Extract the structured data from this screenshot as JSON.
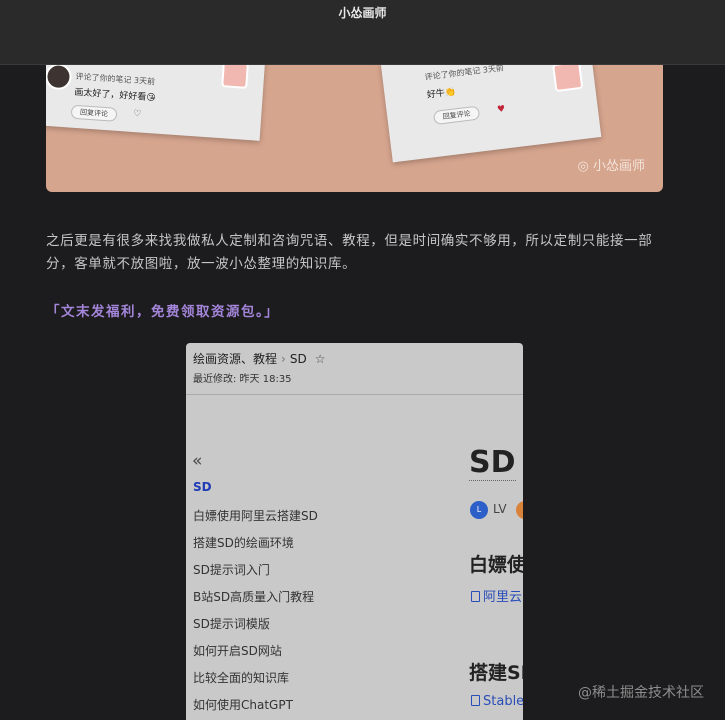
{
  "topbar": {
    "title": "小怂画师"
  },
  "photo": {
    "card1": {
      "line1": "评论了你的笔记  3天前",
      "line2": "画太好了，好好看😘",
      "reply": "回复评论"
    },
    "card2": {
      "line1": "评论了你的笔记  3天前",
      "line2": "好牛👏",
      "reply": "回复评论"
    },
    "watermark": "小怂画师"
  },
  "article": {
    "paragraph": "之后更是有很多来找我做私人定制和咨询咒语、教程，但是时间确实不够用，所以定制只能接一部分，客单就不放图啦，放一波小怂整理的知识库。",
    "highlight": "「文末发福利，免费领取资源包。」"
  },
  "screenshot": {
    "breadcrumb": {
      "parent": "绘画资源、教程",
      "current": "SD"
    },
    "modified": "最近修改: 昨天 18:35",
    "collapse_glyph": "«",
    "nav": [
      "SD",
      "白嫖使用阿里云搭建SD",
      "搭建SD的绘画环境",
      "SD提示词入门",
      "B站SD高质量入门教程",
      "SD提示词模版",
      "如何开启SD网站",
      "比较全面的知识库",
      "如何使用ChatGPT"
    ],
    "doc_title": "SD",
    "author_initial": "L",
    "author_label": "LV",
    "section1_heading": "白嫖使",
    "section1_link": "阿里云",
    "section2_heading": "搭建SD",
    "section2_link": "Stable"
  },
  "site_watermark": "@稀土掘金技术社区",
  "colors": {
    "background": "#1c1b1d",
    "highlight": "#a385d9",
    "link": "#2a4db8"
  }
}
